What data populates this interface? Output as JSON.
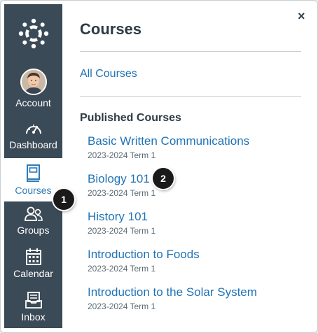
{
  "nav": {
    "account_label": "Account",
    "dashboard_label": "Dashboard",
    "courses_label": "Courses",
    "groups_label": "Groups",
    "calendar_label": "Calendar",
    "inbox_label": "Inbox"
  },
  "tray": {
    "title": "Courses",
    "close_glyph": "×",
    "all_courses": "All Courses",
    "section_heading": "Published Courses",
    "courses": [
      {
        "name": "Basic Written Communications",
        "term": "2023-2024 Term 1"
      },
      {
        "name": "Biology 101",
        "term": "2023-2024 Term 1"
      },
      {
        "name": "History 101",
        "term": "2023-2024 Term 1"
      },
      {
        "name": "Introduction to Foods",
        "term": "2023-2024 Term 1"
      },
      {
        "name": "Introduction to the Solar System",
        "term": "2023-2024 Term 1"
      }
    ]
  },
  "callouts": {
    "one": "1",
    "two": "2"
  },
  "colors": {
    "nav_bg": "#3b4a57",
    "link": "#1f73b6",
    "active_text": "#2d7bb8"
  },
  "icons": [
    "canvas-logo-icon",
    "dashboard-gauge-icon",
    "courses-book-icon",
    "groups-icon",
    "calendar-icon",
    "inbox-icon",
    "close-icon"
  ]
}
